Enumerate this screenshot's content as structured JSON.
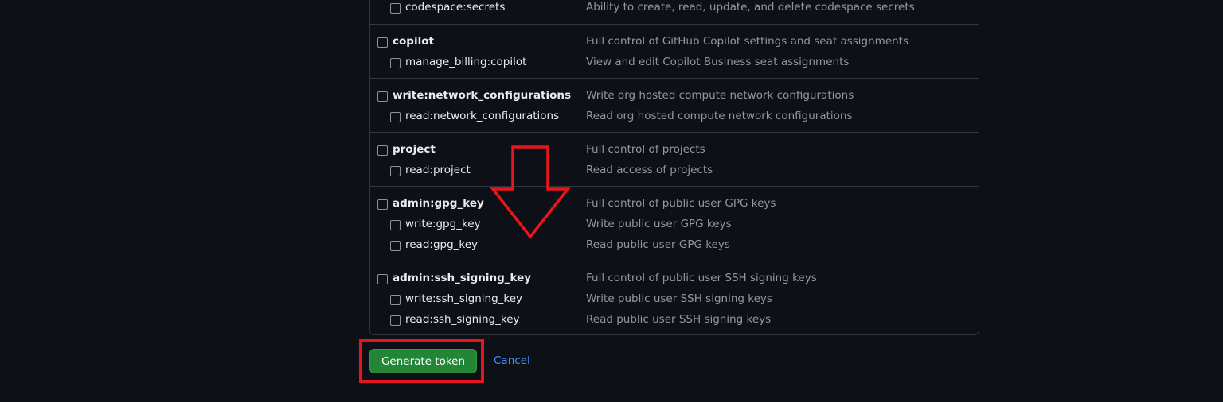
{
  "scopes": {
    "codespace_group": {
      "children": [
        {
          "name": "codespace:secrets",
          "description": "Ability to create, read, update, and delete codespace secrets"
        }
      ]
    },
    "copilot_group": {
      "parent": {
        "name": "copilot",
        "description": "Full control of GitHub Copilot settings and seat assignments"
      },
      "children": [
        {
          "name": "manage_billing:copilot",
          "description": "View and edit Copilot Business seat assignments"
        }
      ]
    },
    "network_group": {
      "parent": {
        "name": "write:network_configurations",
        "description": "Write org hosted compute network configurations"
      },
      "children": [
        {
          "name": "read:network_configurations",
          "description": "Read org hosted compute network configurations"
        }
      ]
    },
    "project_group": {
      "parent": {
        "name": "project",
        "description": "Full control of projects"
      },
      "children": [
        {
          "name": "read:project",
          "description": "Read access of projects"
        }
      ]
    },
    "gpg_group": {
      "parent": {
        "name": "admin:gpg_key",
        "description": "Full control of public user GPG keys"
      },
      "children": [
        {
          "name": "write:gpg_key",
          "description": "Write public user GPG keys"
        },
        {
          "name": "read:gpg_key",
          "description": "Read public user GPG keys"
        }
      ]
    },
    "ssh_group": {
      "parent": {
        "name": "admin:ssh_signing_key",
        "description": "Full control of public user SSH signing keys"
      },
      "children": [
        {
          "name": "write:ssh_signing_key",
          "description": "Write public user SSH signing keys"
        },
        {
          "name": "read:ssh_signing_key",
          "description": "Read public user SSH signing keys"
        }
      ]
    }
  },
  "actions": {
    "generate_label": "Generate token",
    "cancel_label": "Cancel"
  },
  "annotation": {
    "color": "#e8151c"
  },
  "colors": {
    "background": "#0d1117",
    "border": "#30363d",
    "text": "#e6edf3",
    "muted": "#9198a1",
    "button": "#238636",
    "link": "#4493f8"
  }
}
